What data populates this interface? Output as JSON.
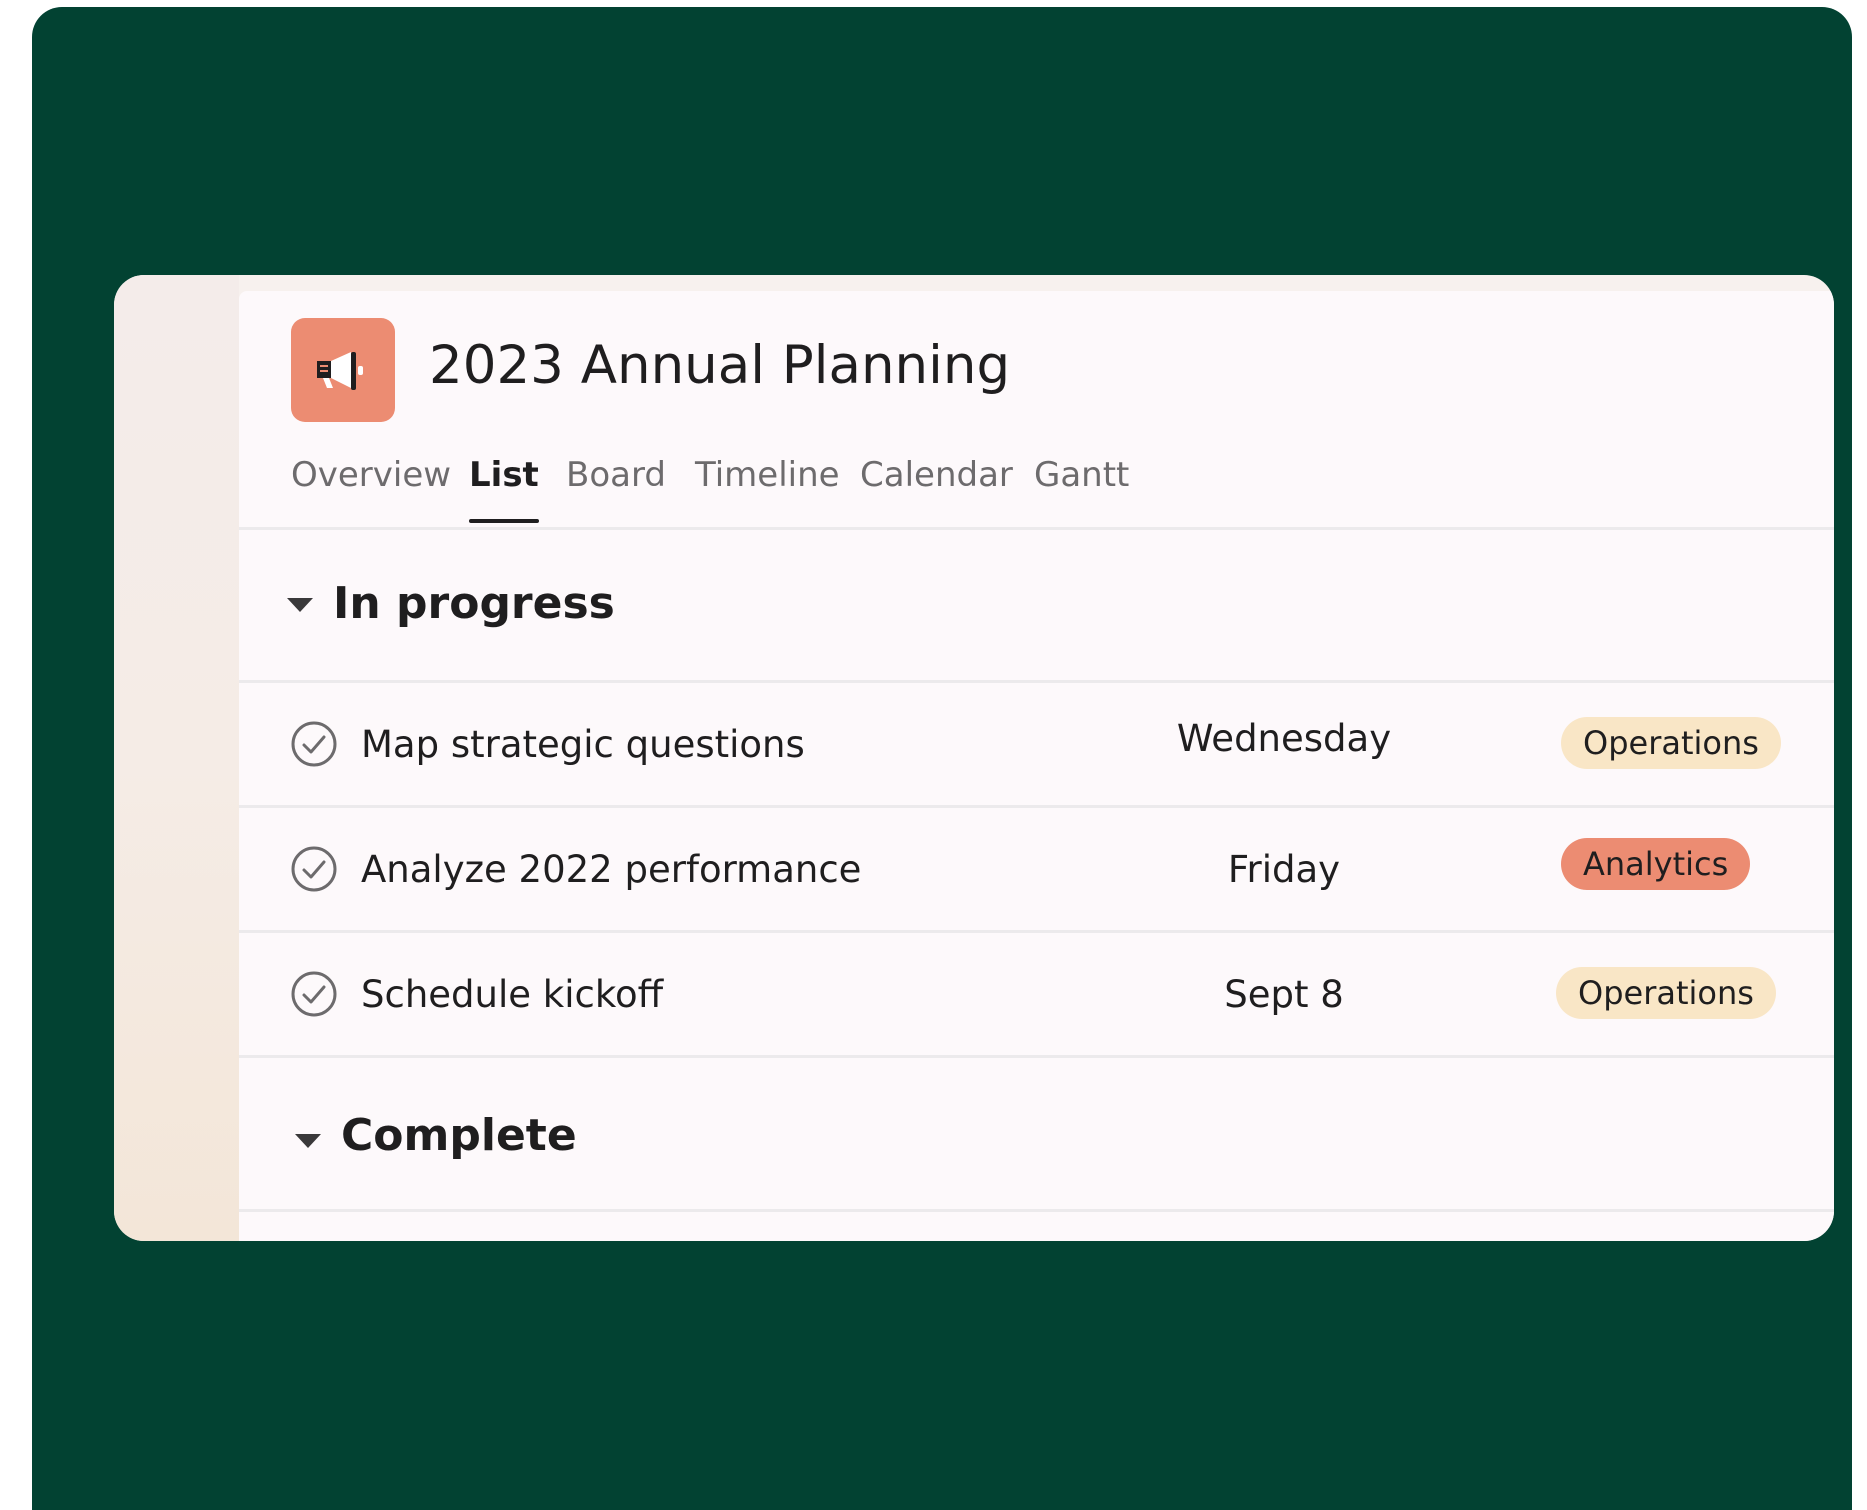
{
  "project": {
    "title": "2023 Annual Planning",
    "icon": "megaphone-icon",
    "icon_color": "#ec8c72"
  },
  "tabs": [
    {
      "label": "Overview",
      "active": false
    },
    {
      "label": "List",
      "active": true
    },
    {
      "label": "Board",
      "active": false
    },
    {
      "label": "Timeline",
      "active": false
    },
    {
      "label": "Calendar",
      "active": false
    },
    {
      "label": "Gantt",
      "active": false
    }
  ],
  "sections": [
    {
      "title": "In progress",
      "tasks": [
        {
          "name": "Map strategic questions",
          "date": "Wednesday",
          "tag": "Operations",
          "tag_color": "#f9e6c6"
        },
        {
          "name": "Analyze 2022 performance",
          "date": "Friday",
          "tag": "Analytics",
          "tag_color": "#ec8c72"
        },
        {
          "name": "Schedule kickoff",
          "date": "Sept 8",
          "tag": "Operations",
          "tag_color": "#f9e6c6"
        }
      ]
    },
    {
      "title": "Complete",
      "tasks": []
    }
  ],
  "colors": {
    "frame_background": "#024232",
    "panel_background": "#fdf9fb"
  }
}
